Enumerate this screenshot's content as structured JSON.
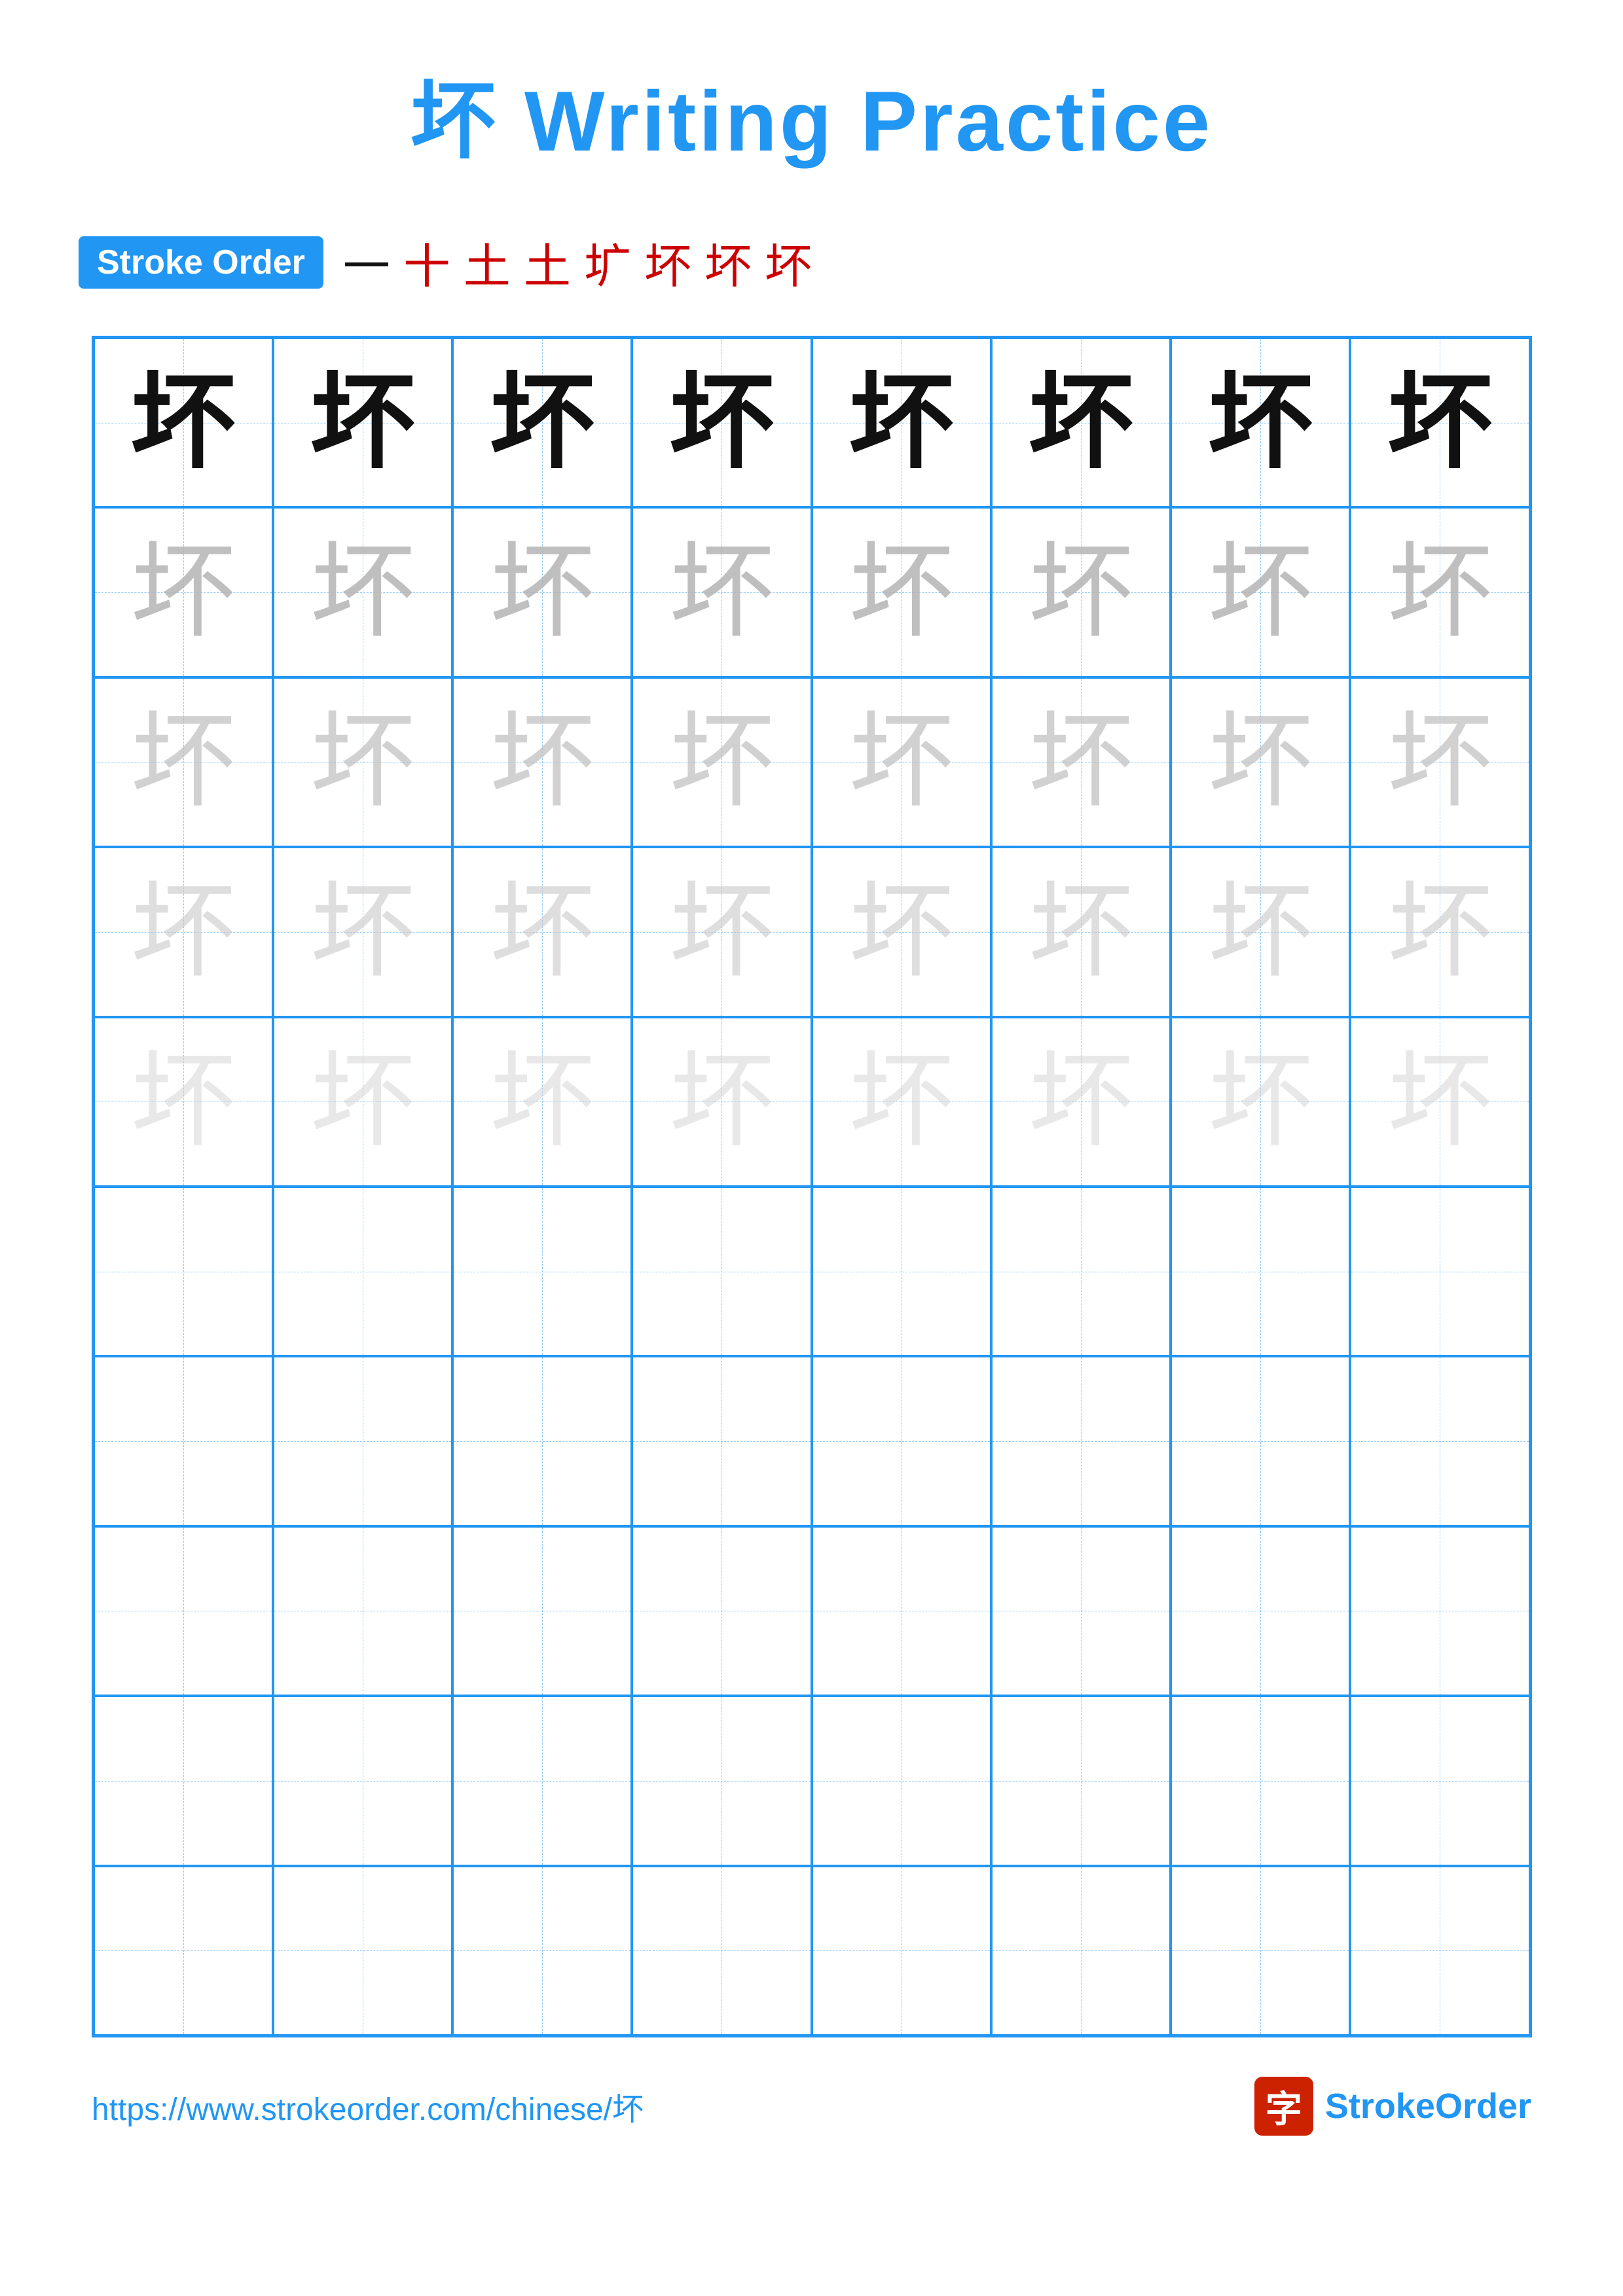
{
  "title": "坏 Writing Practice",
  "stroke_order_badge": "Stroke Order",
  "stroke_sequence": [
    "一",
    "十",
    "土",
    "土",
    "圹",
    "坏",
    "坏",
    "坏"
  ],
  "stroke_first_black": true,
  "character": "坏",
  "grid": {
    "cols": 8,
    "rows": 10,
    "filled_rows": 5,
    "opacity_levels": [
      "black",
      "light1",
      "light2",
      "light3",
      "light4"
    ]
  },
  "footer": {
    "url": "https://www.strokeorder.com/chinese/坏",
    "brand_char": "字",
    "brand_name": "StrokeOrder"
  }
}
